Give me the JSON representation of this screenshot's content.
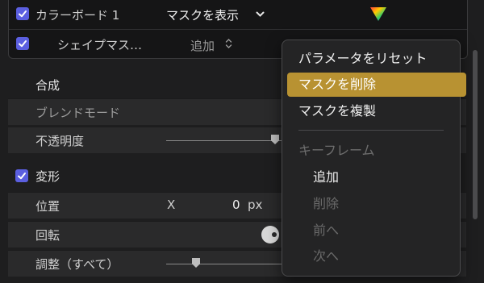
{
  "effect": {
    "name": "カラーボード 1",
    "mask_menu": "マスクを表示",
    "shape_mask": "シェイプマス…",
    "shape_mask_mode": "追加"
  },
  "parameters": {
    "composite_heading": "合成",
    "blend_mode": "ブレンドモード",
    "opacity": "不透明度",
    "transform_heading": "変形",
    "position": "位置",
    "position_axis": "X",
    "position_value": "0",
    "position_unit": "px",
    "rotation": "回転",
    "scale_all": "調整（すべて）"
  },
  "context_menu": {
    "reset_parameter": "パラメータをリセット",
    "delete_mask": "マスクを削除",
    "duplicate_mask": "マスクを複製",
    "keyframe_header": "キーフレーム",
    "add": "追加",
    "delete": "削除",
    "previous": "前へ",
    "next": "次へ"
  },
  "colors": {
    "accent_checkbox": "#5b5fe0",
    "menu_highlight": "#b89232"
  },
  "icons": [
    "checkmark-icon",
    "chevron-down-icon",
    "stepper-icon",
    "color-board-icon",
    "rotation-dial-icon"
  ]
}
